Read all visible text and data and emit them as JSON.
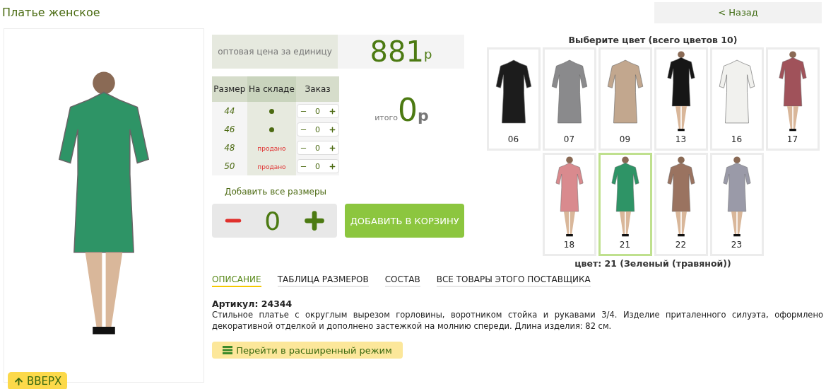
{
  "title": "Платье женское",
  "back_button": "< Назад",
  "up_button": "ВВЕРХ",
  "price": {
    "label": "оптовая цена за единицу",
    "value": "881",
    "currency": "р"
  },
  "sizes": {
    "columns": [
      "Размер",
      "На складе",
      "Заказ"
    ],
    "rows": [
      {
        "size": "44",
        "in_stock": true,
        "quantity": "0"
      },
      {
        "size": "46",
        "in_stock": true,
        "quantity": "0"
      },
      {
        "size": "48",
        "in_stock": false,
        "sold_label": "продано",
        "quantity": "0"
      },
      {
        "size": "50",
        "in_stock": false,
        "sold_label": "продано",
        "quantity": "0"
      }
    ]
  },
  "total": {
    "label": "итого",
    "value": "0",
    "currency": "р"
  },
  "add_all": {
    "label": "Добавить все размеры",
    "quantity": "0"
  },
  "cart_button": "ДОБАВИТЬ В КОРЗИНУ",
  "colors": {
    "heading": "Выберите цвет (всего цветов 10)",
    "items": [
      {
        "code": "06",
        "kind": "flat",
        "color": "#1c1c1c",
        "selected": false
      },
      {
        "code": "07",
        "kind": "flat",
        "color": "#8a8a8c",
        "selected": false
      },
      {
        "code": "09",
        "kind": "flat",
        "color": "#c2a78e",
        "selected": false
      },
      {
        "code": "13",
        "kind": "model",
        "color": "#161616",
        "selected": false
      },
      {
        "code": "16",
        "kind": "flat",
        "color": "#f1f1ee",
        "selected": false
      },
      {
        "code": "17",
        "kind": "model",
        "color": "#a0525a",
        "selected": false
      },
      {
        "code": "18",
        "kind": "model",
        "color": "#d98a8e",
        "selected": false
      },
      {
        "code": "21",
        "kind": "model",
        "color": "#2e9466",
        "selected": true
      },
      {
        "code": "22",
        "kind": "model",
        "color": "#9a7360",
        "selected": false
      },
      {
        "code": "23",
        "kind": "model",
        "color": "#9a9aa8",
        "selected": false
      }
    ],
    "caption": "цвет: 21 (Зеленый (травяной))"
  },
  "tabs": [
    {
      "label": "ОПИСАНИЕ",
      "selected": true
    },
    {
      "label": "ТАБЛИЦА РАЗМЕРОВ",
      "selected": false
    },
    {
      "label": "СОСТАВ",
      "selected": false
    },
    {
      "label": "ВСЕ ТОВАРЫ ЭТОГО ПОСТАВЩИКА",
      "selected": false
    }
  ],
  "article": "Артикул: 24344",
  "description": "Стильное платье с округлым вырезом горловины, воротником стойка и рукавами 3/4. Изделие приталенного силуэта, оформлено декоративной отделкой и дополнено застежкой на молнию спереди. Длина изделия: 82 см.",
  "advanced_button": "Перейти в расширенный режим"
}
